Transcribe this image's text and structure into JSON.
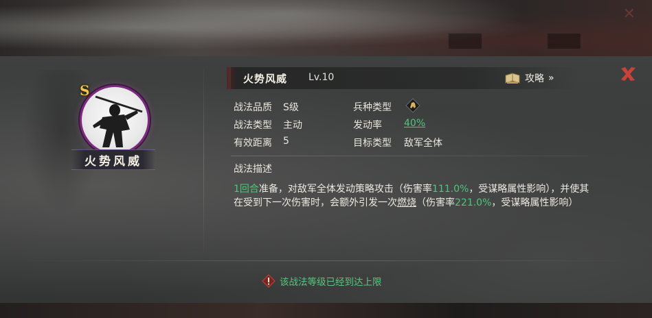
{
  "skill": {
    "name": "火势风威",
    "level": "Lv.10",
    "grade_badge": "S",
    "portrait_caption": "火势风威"
  },
  "header": {
    "guide_label": "攻略",
    "guide_chevron": "»"
  },
  "info": {
    "quality_label": "战法品质",
    "quality_value": "S级",
    "type_label": "战法类型",
    "type_value": "主动",
    "range_label": "有效距离",
    "range_value": "5",
    "troop_label": "兵种类型",
    "troop_icon": "cavalry-icon",
    "rate_label": "发动率",
    "rate_value": "40%",
    "target_label": "目标类型",
    "target_value": "敌军全体"
  },
  "description": {
    "title": "战法描述",
    "seg1": "1回合",
    "seg2": "准备，对敌军全体发动策略攻击（伤害率",
    "seg3": "111.0%",
    "seg4": "，受谋略属性影响），并使其在受到下一次伤害时，会额外引发一次",
    "seg5": "燃烧",
    "seg6": "（伤害率",
    "seg7": "221.0%",
    "seg8": "，受谋略属性影响）"
  },
  "notice": {
    "text": "该战法等级已经到达上限"
  },
  "colors": {
    "accent_green": "#4dc87a",
    "close_red": "#c8423a",
    "frame_purple": "#7c2a80",
    "grade_gold": "#f0c54a"
  }
}
